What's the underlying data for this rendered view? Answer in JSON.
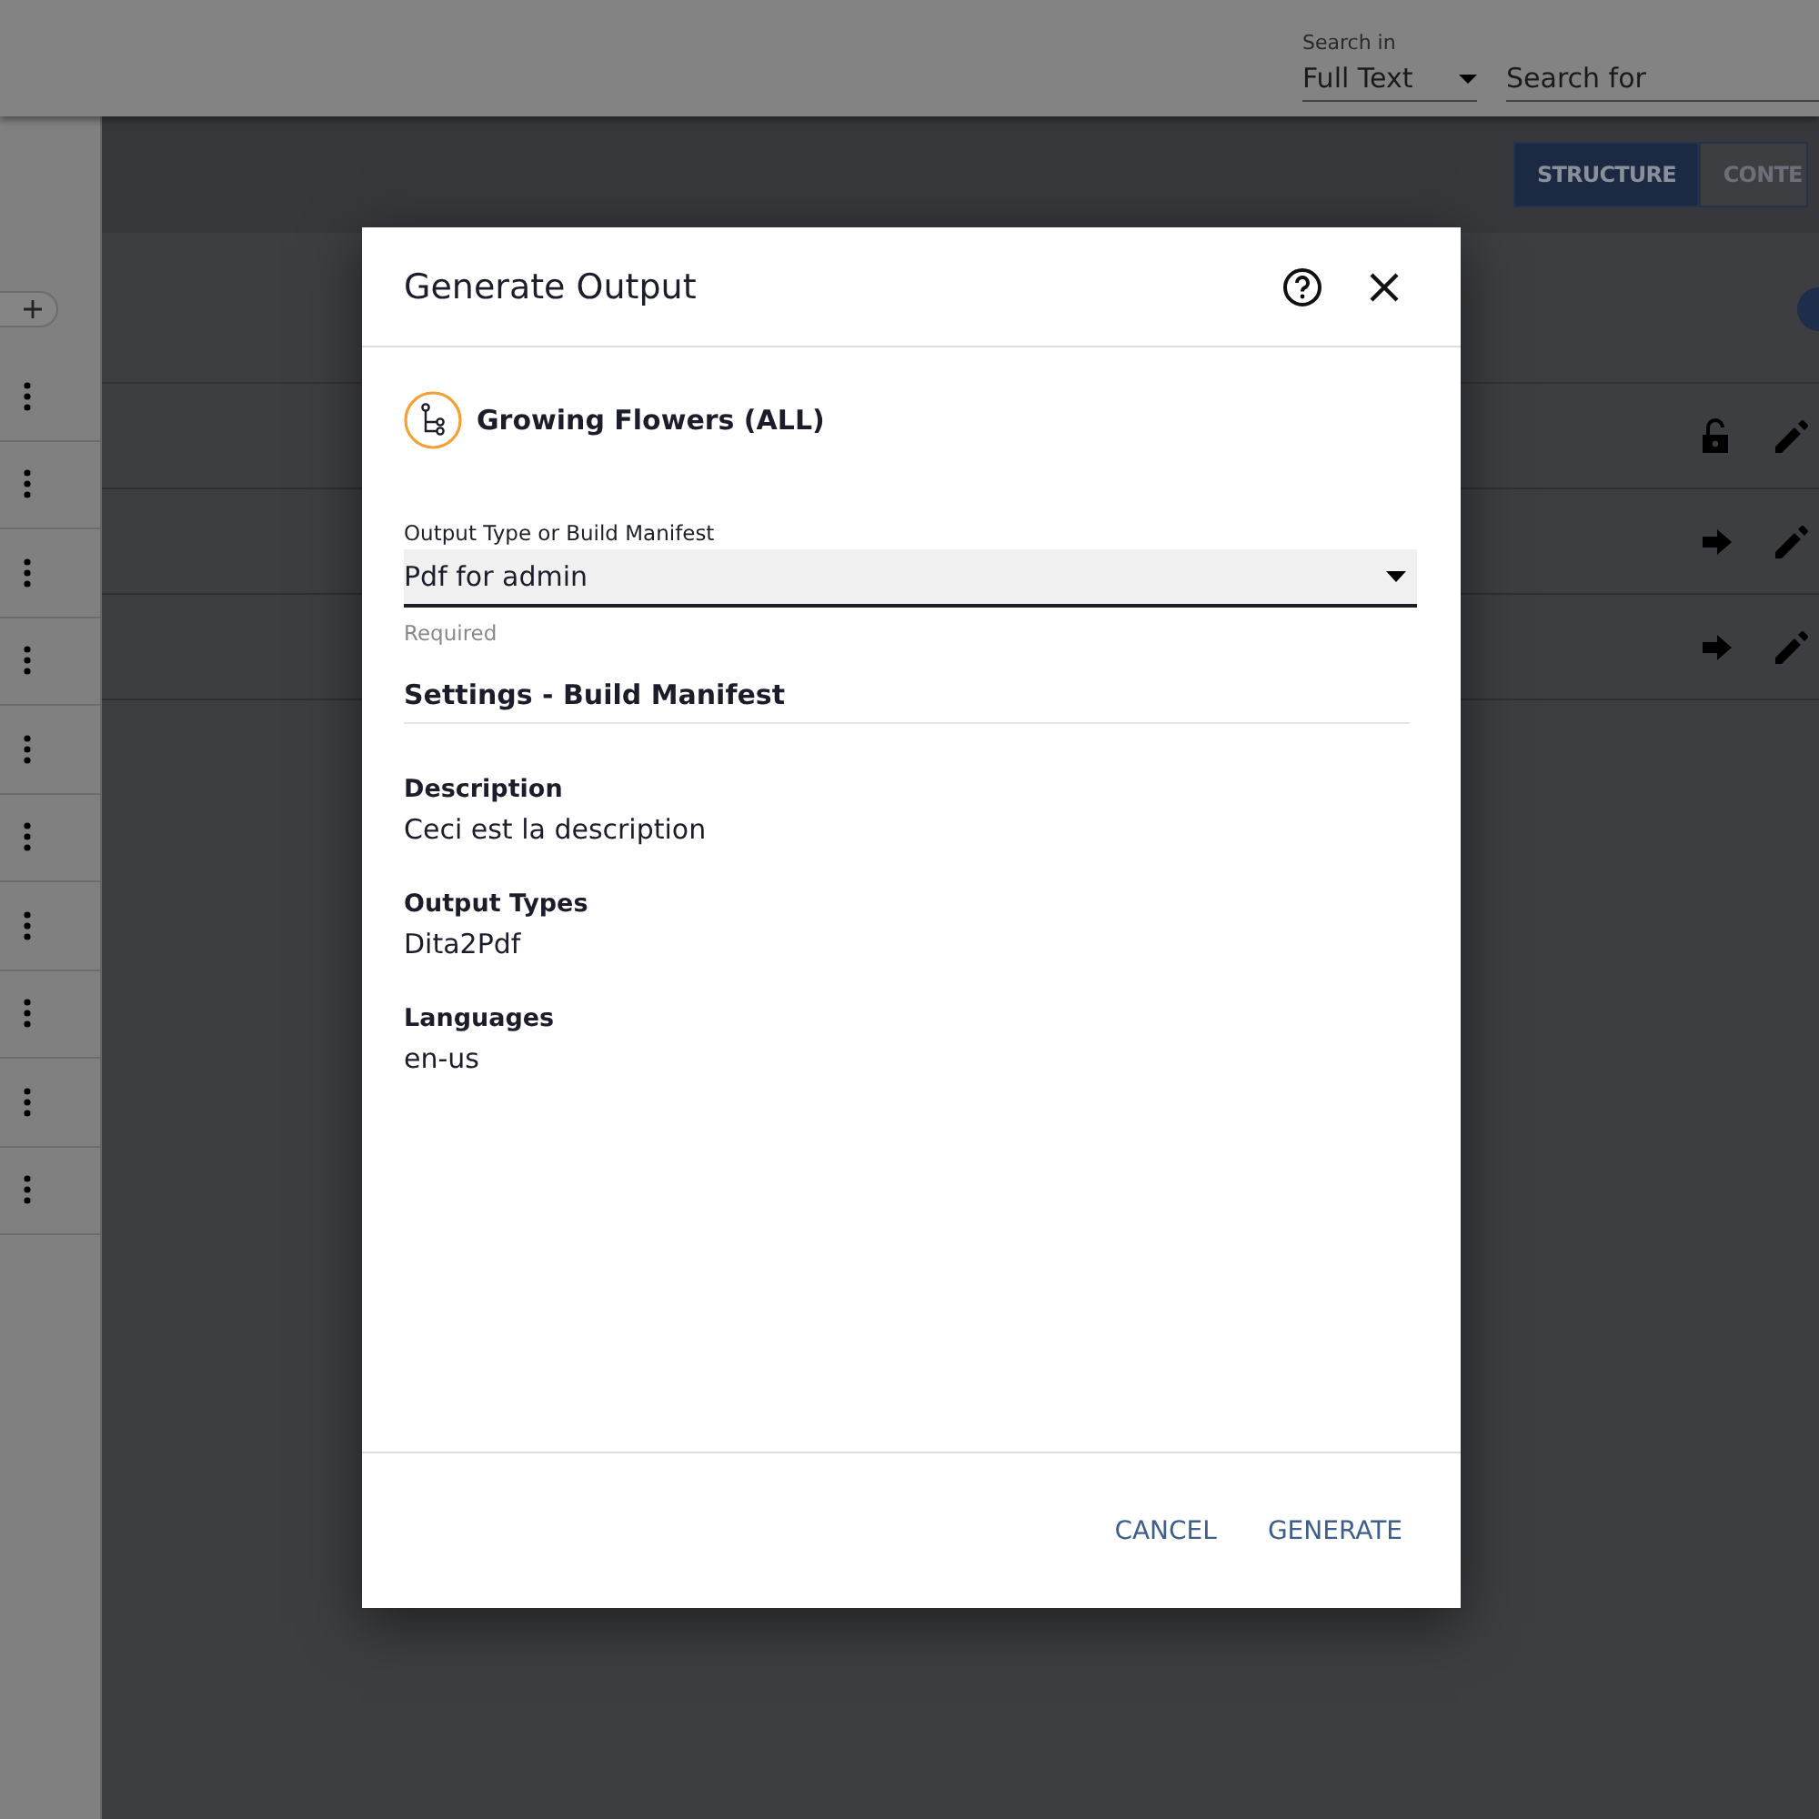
{
  "top_bar": {
    "search_in": {
      "label": "Search in",
      "value": "Full Text"
    },
    "search": {
      "placeholder": "Search for"
    }
  },
  "view_tabs": [
    {
      "label": "STRUCTURE",
      "selected": true
    },
    {
      "label": "CONTE",
      "selected": false
    }
  ],
  "rail_rows": [
    {
      "kind": "menu"
    },
    {
      "kind": "menu"
    },
    {
      "kind": "menu"
    },
    {
      "kind": "menu"
    },
    {
      "kind": "menu"
    },
    {
      "kind": "menu"
    },
    {
      "kind": "menu"
    },
    {
      "kind": "menu"
    },
    {
      "kind": "menu"
    },
    {
      "kind": "menu"
    }
  ],
  "table_rows": [
    {
      "kind": "unlocked"
    },
    {
      "kind": "forward"
    },
    {
      "kind": "forward"
    }
  ],
  "dialog": {
    "title": "Generate Output",
    "item": "Growing Flowers (ALL)",
    "field": {
      "label": "Output Type or Build Manifest",
      "value": "Pdf for admin",
      "helper": "Required"
    },
    "section": "Settings - Build Manifest",
    "details": [
      {
        "label": "Description",
        "value": "Ceci est la description"
      },
      {
        "label": "Output Types",
        "value": "Dita2Pdf"
      },
      {
        "label": "Languages",
        "value": "en-us"
      }
    ],
    "buttons": [
      "CANCEL",
      "GENERATE"
    ]
  }
}
